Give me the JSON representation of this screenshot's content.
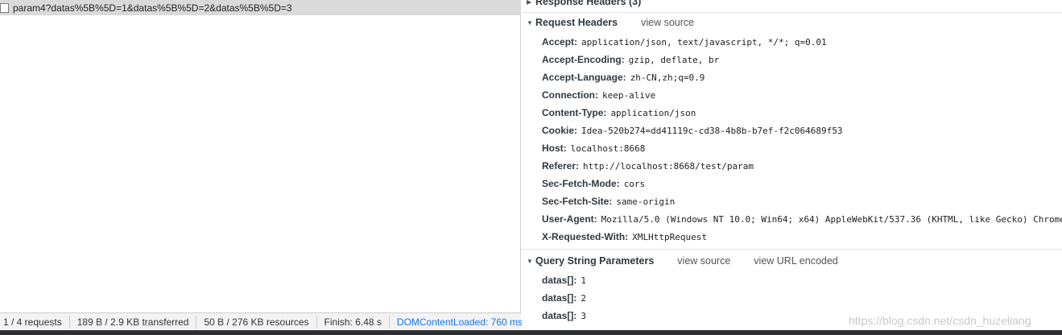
{
  "request_list": {
    "row": {
      "name": "param4?datas%5B%5D=1&datas%5B%5D=2&datas%5B%5D=3"
    }
  },
  "status_bar": {
    "requests": "1 / 4 requests",
    "transferred": "189 B / 2.9 KB transferred",
    "resources": "50 B / 276 KB resources",
    "finish": "Finish: 6.48 s",
    "dom_loaded": "DOMContentLoaded: 760 ms"
  },
  "response_headers": {
    "title": "Response Headers (3)"
  },
  "request_headers": {
    "title": "Request Headers",
    "view_source": "view source",
    "items": [
      {
        "name": "Accept:",
        "value": "application/json, text/javascript, */*; q=0.01"
      },
      {
        "name": "Accept-Encoding:",
        "value": "gzip, deflate, br"
      },
      {
        "name": "Accept-Language:",
        "value": "zh-CN,zh;q=0.9"
      },
      {
        "name": "Connection:",
        "value": "keep-alive"
      },
      {
        "name": "Content-Type:",
        "value": "application/json"
      },
      {
        "name": "Cookie:",
        "value": "Idea-520b274=dd41119c-cd38-4b8b-b7ef-f2c064689f53"
      },
      {
        "name": "Host:",
        "value": "localhost:8668"
      },
      {
        "name": "Referer:",
        "value": "http://localhost:8668/test/param"
      },
      {
        "name": "Sec-Fetch-Mode:",
        "value": "cors"
      },
      {
        "name": "Sec-Fetch-Site:",
        "value": "same-origin"
      },
      {
        "name": "User-Agent:",
        "value": "Mozilla/5.0 (Windows NT 10.0; Win64; x64) AppleWebKit/537.36 (KHTML, like Gecko) Chrome"
      },
      {
        "name": "X-Requested-With:",
        "value": "XMLHttpRequest"
      }
    ]
  },
  "query_params": {
    "title": "Query String Parameters",
    "view_source": "view source",
    "view_url_encoded": "view URL encoded",
    "items": [
      {
        "name": "datas[]:",
        "value": "1"
      },
      {
        "name": "datas[]:",
        "value": "2"
      },
      {
        "name": "datas[]:",
        "value": "3"
      }
    ]
  },
  "watermark": {
    "text": "https://blog.csdn.net/csdn_huzeliang"
  },
  "icons": {
    "expanded": "triangle-down-icon",
    "collapsed": "triangle-right-icon"
  },
  "colors": {
    "selected_row": "#dadada",
    "link_blue": "#1a73e8",
    "status_bg": "#f3f3f3"
  }
}
